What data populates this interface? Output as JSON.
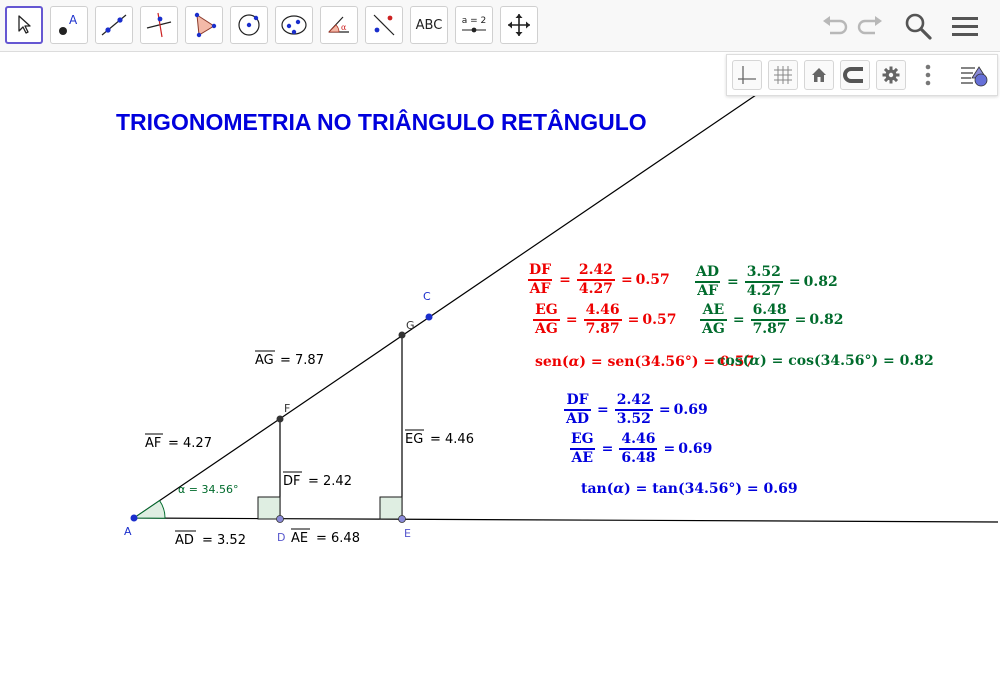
{
  "title": {
    "text": "TRIGONOMETRIA NO TRIÂNGULO RETÂNGULO"
  },
  "toolbar": {
    "tools": [
      {
        "name": "move-tool",
        "icon": "cursor-arrow-icon"
      },
      {
        "name": "point-tool",
        "icon": "point-icon",
        "label": "A"
      },
      {
        "name": "line-tool",
        "icon": "line-through-points-icon"
      },
      {
        "name": "perpendicular-tool",
        "icon": "perpendicular-line-icon"
      },
      {
        "name": "polygon-tool",
        "icon": "polygon-icon"
      },
      {
        "name": "circle-tool",
        "icon": "circle-center-point-icon"
      },
      {
        "name": "conic-tool",
        "icon": "ellipse-icon"
      },
      {
        "name": "angle-tool",
        "icon": "angle-icon"
      },
      {
        "name": "reflect-tool",
        "icon": "reflect-about-line-icon"
      },
      {
        "name": "text-tool",
        "icon": "text-icon",
        "label": "ABC"
      },
      {
        "name": "slider-tool",
        "icon": "slider-icon",
        "label": "a = 2"
      },
      {
        "name": "move-graphics-tool",
        "icon": "move-arrows-icon"
      }
    ],
    "right_icons": [
      "undo-icon",
      "redo-icon",
      "search-icon",
      "menu-icon"
    ]
  },
  "stylebar": {
    "icons": [
      "axes-icon",
      "grid-icon",
      "home-icon",
      "point-capture-icon",
      "settings-icon",
      "more-vert-icon",
      "algebra-view-icon"
    ]
  },
  "colors": {
    "accent": "#6557d2",
    "red": "#ee0000",
    "green": "#006b2c",
    "blue": "#0000dd",
    "title": "#0000dd",
    "point": "#1a2ecc",
    "point_label": "#3333cc"
  },
  "geometry": {
    "point_labels": {
      "A": "A",
      "C": "C",
      "D": "D",
      "E": "E",
      "F": "F",
      "G": "G"
    },
    "segment_names": {
      "AG": "AG",
      "AF": "AF",
      "DF": "DF",
      "EG": "EG",
      "AD": "AD",
      "AE": "AE"
    },
    "segment_values": {
      "AG": "= 7.87",
      "AF": "= 4.27",
      "DF": "= 2.42",
      "EG": "= 4.46",
      "AD": "= 3.52",
      "AE": "= 6.48"
    },
    "angle_label": "α = 34.56°"
  },
  "formulas": {
    "red": [
      {
        "num": "DF",
        "den": "AF",
        "num_v": "2.42",
        "den_v": "4.27",
        "result": "0.57"
      },
      {
        "num": "EG",
        "den": "AG",
        "num_v": "4.46",
        "den_v": "7.87",
        "result": "0.57"
      }
    ],
    "green": [
      {
        "num": "AD",
        "den": "AF",
        "num_v": "3.52",
        "den_v": "4.27",
        "result": "0.82"
      },
      {
        "num": "AE",
        "den": "AG",
        "num_v": "6.48",
        "den_v": "7.87",
        "result": "0.82"
      }
    ],
    "blue": [
      {
        "num": "DF",
        "den": "AD",
        "num_v": "2.42",
        "den_v": "3.52",
        "result": "0.69"
      },
      {
        "num": "EG",
        "den": "AE",
        "num_v": "4.46",
        "den_v": "6.48",
        "result": "0.69"
      }
    ],
    "sen_line": {
      "fn": "sen",
      "var": "α",
      "angle": "34.56°",
      "result": "0.57"
    },
    "cos_line": {
      "fn": "cos",
      "var": "α",
      "angle": "34.56°",
      "result": "0.82"
    },
    "tan_line": {
      "fn": "tan",
      "var": "α",
      "angle": "34.56°",
      "result": "0.69"
    }
  }
}
